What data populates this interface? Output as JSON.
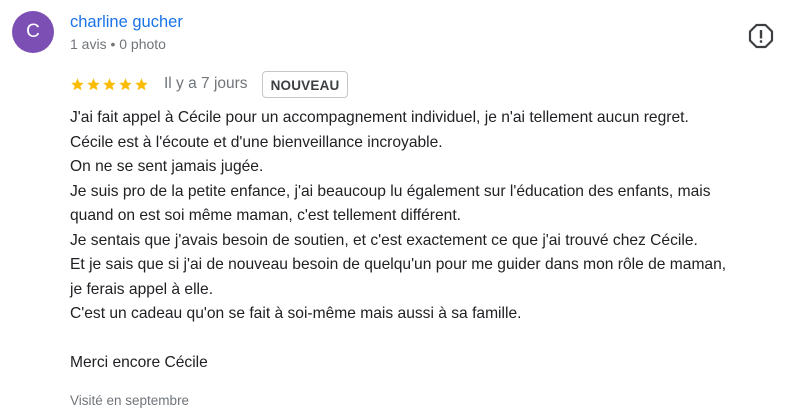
{
  "review": {
    "avatar_initial": "C",
    "avatar_color": "#7b4fb4",
    "author_name": "charline gucher",
    "author_meta": "1 avis • 0 photo",
    "rating": 5,
    "rating_max": 5,
    "star_color": "#fbbc04",
    "time_ago": "Il y a 7 jours",
    "badge": "NOUVEAU",
    "report_icon": "report-icon",
    "text_lines": [
      "J'ai fait appel à Cécile pour un accompagnement individuel, je n'ai tellement aucun regret.",
      "Cécile est à l'écoute et d'une bienveillance incroyable.",
      "On ne se sent jamais jugée.",
      "Je suis pro de la petite enfance, j'ai beaucoup lu également sur l'éducation des enfants, mais",
      "quand on est soi même maman, c'est tellement différent.",
      "Je sentais que j'avais besoin de soutien, et c'est exactement ce que j'ai trouvé chez Cécile.",
      "Et je sais que si j'ai de nouveau besoin de quelqu'un pour me guider dans mon rôle de maman,",
      "je ferais appel à elle.",
      "C'est un cadeau qu'on se fait à soi-même mais aussi à sa famille.",
      "",
      "Merci encore Cécile"
    ],
    "visited": "Visité en septembre"
  }
}
